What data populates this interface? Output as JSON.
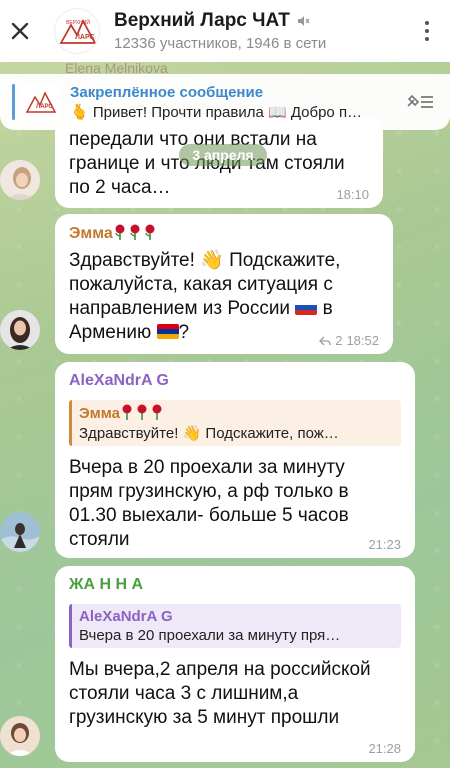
{
  "header": {
    "title": "Верхний Ларс ЧАТ",
    "subtitle": "12336 участников, 1946 в сети",
    "logo_text_top": "ВЕРХНИЙ",
    "logo_text_bottom": "ЛАРС"
  },
  "pinned": {
    "title": "Закреплённое сообщение",
    "message": "🫰 Привет! Прочти правила 📖  Добро п…"
  },
  "faded_sender": "Elena Melnikova",
  "date_separator": "3 апреля",
  "messages": [
    {
      "text": "передали что они встали на границе и что люди там стояли по 2 часа…",
      "time": "18:10"
    },
    {
      "sender": "Эмма",
      "sender_color": "#c17a2c",
      "text_part1": "Здравствуйте! 👋 Подскажите, пожалуйста, какая ситуация с направлением из России",
      "text_part2": "в Армению",
      "text_part3": "?",
      "replies_count": "2",
      "time": "18:52"
    },
    {
      "sender": "AleXaNdrA G",
      "sender_color": "#8a63c3",
      "reply_name": "Эмма",
      "reply_text": "Здравствуйте! 👋 Подскажите, пож…",
      "text": "Вчера в 20 проехали за минуту прям грузинскую, а рф только в 01.30 выехали- больше 5 часов стояли",
      "time": "21:23"
    },
    {
      "sender": "ЖА Н Н А",
      "sender_color": "#4aa040",
      "reply_name": "AleXaNdrA G",
      "reply_text": "Вчера в 20 проехали за минуту пря…",
      "text": "Мы вчера,2 апреля на российской стояли часа 3 с лишним,а грузинскую за 5 минут прошли",
      "time": "21:28"
    }
  ],
  "colors": {
    "accent_blue": "#3d87cc",
    "time_gray": "#9aa0a6"
  }
}
